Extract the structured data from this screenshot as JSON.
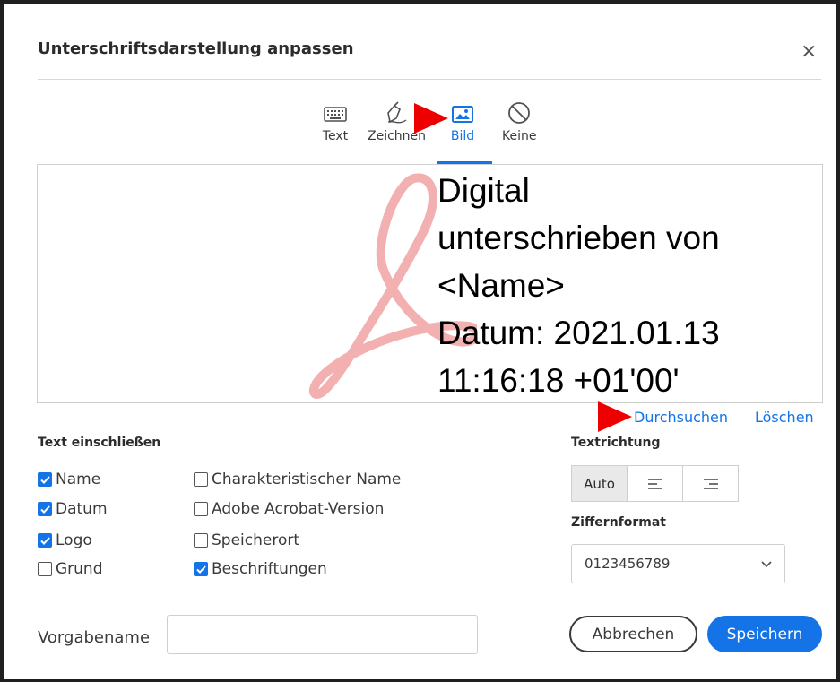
{
  "dialog": {
    "title": "Unterschriftsdarstellung anpassen",
    "close_glyph": "×"
  },
  "tabs": [
    {
      "label": "Text",
      "icon": "keyboard-icon"
    },
    {
      "label": "Zeichnen",
      "icon": "pen-icon"
    },
    {
      "label": "Bild",
      "icon": "image-icon",
      "active": true
    },
    {
      "label": "Keine",
      "icon": "no-icon"
    }
  ],
  "preview": {
    "lines": [
      "Digital",
      "unterschrieben von",
      "<Name>",
      "Datum: 2021.01.13",
      "11:16:18 +01'00'"
    ]
  },
  "links": {
    "browse": "Durchsuchen",
    "delete": "Löschen"
  },
  "include_text": {
    "label": "Text einschließen",
    "options": [
      {
        "label": "Name",
        "checked": true
      },
      {
        "label": "Datum",
        "checked": true
      },
      {
        "label": "Logo",
        "checked": true
      },
      {
        "label": "Grund",
        "checked": false
      },
      {
        "label": "Charakteristischer Name",
        "checked": false
      },
      {
        "label": "Adobe Acrobat-Version",
        "checked": false
      },
      {
        "label": "Speicherort",
        "checked": false
      },
      {
        "label": "Beschriftungen",
        "checked": true
      }
    ]
  },
  "text_direction": {
    "label": "Textrichtung",
    "auto_label": "Auto",
    "selected": "Auto"
  },
  "digit_format": {
    "label": "Ziffernformat",
    "value": "0123456789"
  },
  "preset": {
    "label": "Vorgabename",
    "value": "",
    "placeholder": ""
  },
  "buttons": {
    "cancel": "Abbrechen",
    "save": "Speichern"
  },
  "colors": {
    "accent": "#1473e6",
    "annotation_arrow": "#ee0000"
  }
}
